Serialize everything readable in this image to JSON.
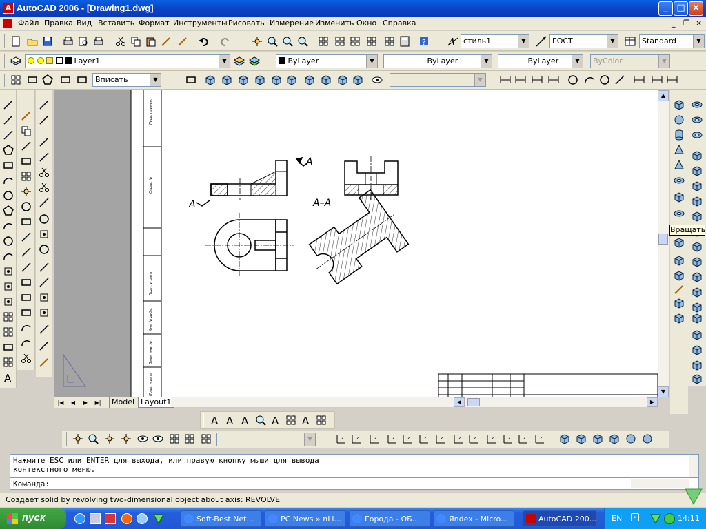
{
  "window": {
    "title": "AutoCAD 2006 - [Drawing1.dwg]",
    "app_icon_letter": "A"
  },
  "menu": {
    "items": [
      "Файл",
      "Правка",
      "Вид",
      "Вставить",
      "Формат",
      "Инструменты",
      "Рисовать",
      "Измерение",
      "Изменить",
      "Окно",
      "Справка"
    ]
  },
  "styles_toolbar": {
    "text_style": "стиль1",
    "dim_style": "ГОСТ",
    "table_style": "Standard"
  },
  "layers_toolbar": {
    "layer": "Layer1",
    "color": "ByLayer",
    "linetype": "ByLayer",
    "lineweight": "ByLayer",
    "plotstyle": "ByColor"
  },
  "viewports_toolbar": {
    "scale": "Вписать"
  },
  "drawing": {
    "labels": {
      "view_a_top": "A",
      "view_a_left": "A",
      "section": "A–A"
    },
    "frame_text": [
      "Перв. примен.",
      "Справ. №",
      "Подп. и дата",
      "Инв. № дубл.",
      "Взам. инв. №",
      "Подп. и дата"
    ]
  },
  "layout_tabs": {
    "tabs": [
      "Model",
      "Layout1"
    ],
    "active": "Layout1"
  },
  "tooltip": {
    "text": "Вращать"
  },
  "command": {
    "history_line1": "Нажмите ESC или ENTER для выхода, или правую кнопку мыши для вывода",
    "history_line2": "контекстного меню.",
    "prompt": "Команда:"
  },
  "status": {
    "text": "Создает solid by revolving two-dimensional object about axis:  REVOLVE"
  },
  "taskbar": {
    "start_label": "пуск",
    "tasks": [
      "Soft-Best.Net...",
      "PC News » nLi...",
      "Города - ОБ...",
      "Яndex - Micro...",
      "AutoCAD 200..."
    ],
    "active_index": 4,
    "lang": "EN",
    "clock": "14:11"
  },
  "colors": {
    "titlebar": "#0b46c9",
    "taskbar": "#245edc",
    "start_button": "#2f8a31",
    "paper_grey": "#a4a4a4"
  }
}
